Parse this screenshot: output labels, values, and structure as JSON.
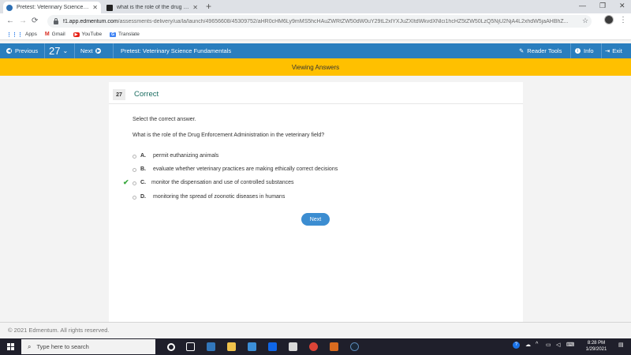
{
  "browser": {
    "tabs": [
      {
        "title": "Pretest: Veterinary Science Fund...",
        "close": "✕"
      },
      {
        "title": "what is the role of the drug enfo...",
        "close": "✕"
      }
    ],
    "new_tab": "+",
    "window_controls": {
      "minimize": "—",
      "maximize": "❐",
      "close": "✕"
    },
    "nav": {
      "back": "←",
      "forward": "→",
      "reload": "C"
    },
    "url_host": "f1.app.edmentum.com",
    "url_path": "/assessments-delivery/ua/la/launch/49656608/45309752/aHR0cHM6Ly9mMS5hcHAuZWRtZW50dW0uY29tL2xlYXJuZXItdWkvdXNlci1hcHZ5tZW50LzQ5NjU2NjA4L2xhdW5jaAHBhZ...",
    "star": "☆",
    "menu": "⋮",
    "bookmarks": [
      {
        "icon": "apps-grid",
        "label": "Apps"
      },
      {
        "icon": "gmail",
        "label": "Gmail"
      },
      {
        "icon": "youtube",
        "label": "YouTube"
      },
      {
        "icon": "translate",
        "label": "Translate"
      }
    ]
  },
  "app": {
    "previous_label": "Previous",
    "question_number": "27",
    "next_label": "Next",
    "title": "Pretest: Veterinary Science Fundamentals",
    "reader_tools_label": "Reader Tools",
    "info_label": "Info",
    "exit_label": "Exit",
    "banner": "Viewing Answers"
  },
  "question": {
    "number": "27",
    "status": "Correct",
    "instruction": "Select the correct answer.",
    "stem": "What is the role of the Drug Enforcement Administration in the veterinary field?",
    "options": [
      {
        "letter": "A.",
        "text": "permit euthanizing animals",
        "correct": false
      },
      {
        "letter": "B.",
        "text": "evaluate whether veterinary practices are making ethically correct decisions",
        "correct": false
      },
      {
        "letter": "C.",
        "text": "monitor the dispensation and use of controlled substances",
        "correct": true,
        "mark": "✔"
      },
      {
        "letter": "D.",
        "text": "monitoring the spread of zoonotic diseases in humans",
        "correct": false
      }
    ],
    "next_button": "Next"
  },
  "footer": "© 2021 Edmentum. All rights reserved.",
  "taskbar": {
    "search_placeholder": "Type here to search",
    "time": "8:28 PM",
    "date": "1/29/2021",
    "tray_help": "?"
  },
  "colors": {
    "toolbar_blue": "#2a7ebe",
    "banner_yellow": "#ffc000",
    "correct_green": "#1a6c60",
    "check_green": "#39a83e",
    "button_blue": "#3c8dd1"
  }
}
